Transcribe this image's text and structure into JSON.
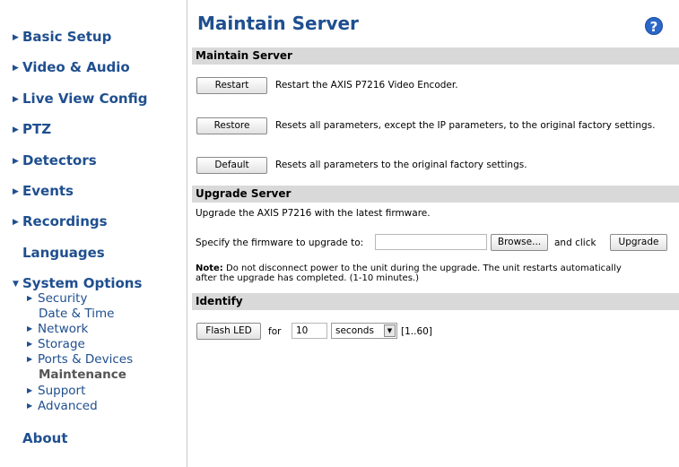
{
  "sidebar": {
    "sections": [
      {
        "label": "Basic Setup"
      },
      {
        "label": "Video & Audio"
      },
      {
        "label": "Live View Config"
      },
      {
        "label": "PTZ"
      },
      {
        "label": "Detectors"
      },
      {
        "label": "Events"
      },
      {
        "label": "Recordings"
      },
      {
        "label": "Languages"
      },
      {
        "label": "System Options"
      },
      {
        "label": "About"
      }
    ],
    "system_options_items": [
      {
        "label": "Security"
      },
      {
        "label": "Date & Time"
      },
      {
        "label": "Network"
      },
      {
        "label": "Storage"
      },
      {
        "label": "Ports & Devices"
      },
      {
        "label": "Maintenance"
      },
      {
        "label": "Support"
      },
      {
        "label": "Advanced"
      }
    ]
  },
  "main": {
    "title": "Maintain Server",
    "help_icon": "?",
    "maintain": {
      "header": "Maintain Server",
      "restart_label": "Restart",
      "restart_desc": "Restart the AXIS P7216 Video Encoder.",
      "restore_label": "Restore",
      "restore_desc": "Resets all parameters, except the IP parameters, to the original factory settings.",
      "default_label": "Default",
      "default_desc": "Resets all parameters to the original factory settings."
    },
    "upgrade": {
      "header": "Upgrade Server",
      "intro": "Upgrade the AXIS P7216 with the latest firmware.",
      "specify_label": "Specify the firmware to upgrade to:",
      "file_value": "",
      "browse_label": "Browse...",
      "and_click": "and click",
      "upgrade_label": "Upgrade",
      "note_bold": "Note:",
      "note_line1": " Do not disconnect power to the unit during the upgrade. The unit restarts automatically",
      "note_line2": "after the upgrade has completed. (1-10 minutes.)"
    },
    "identify": {
      "header": "Identify",
      "flash_label": "Flash LED",
      "for_label": "for",
      "duration_value": "10",
      "unit_selected": "seconds",
      "range_hint": "[1..60]"
    }
  },
  "colors": {
    "nav_blue": "#1f4f8f",
    "section_bar": "#d9d9d9",
    "help_blue": "#2a67c9"
  }
}
